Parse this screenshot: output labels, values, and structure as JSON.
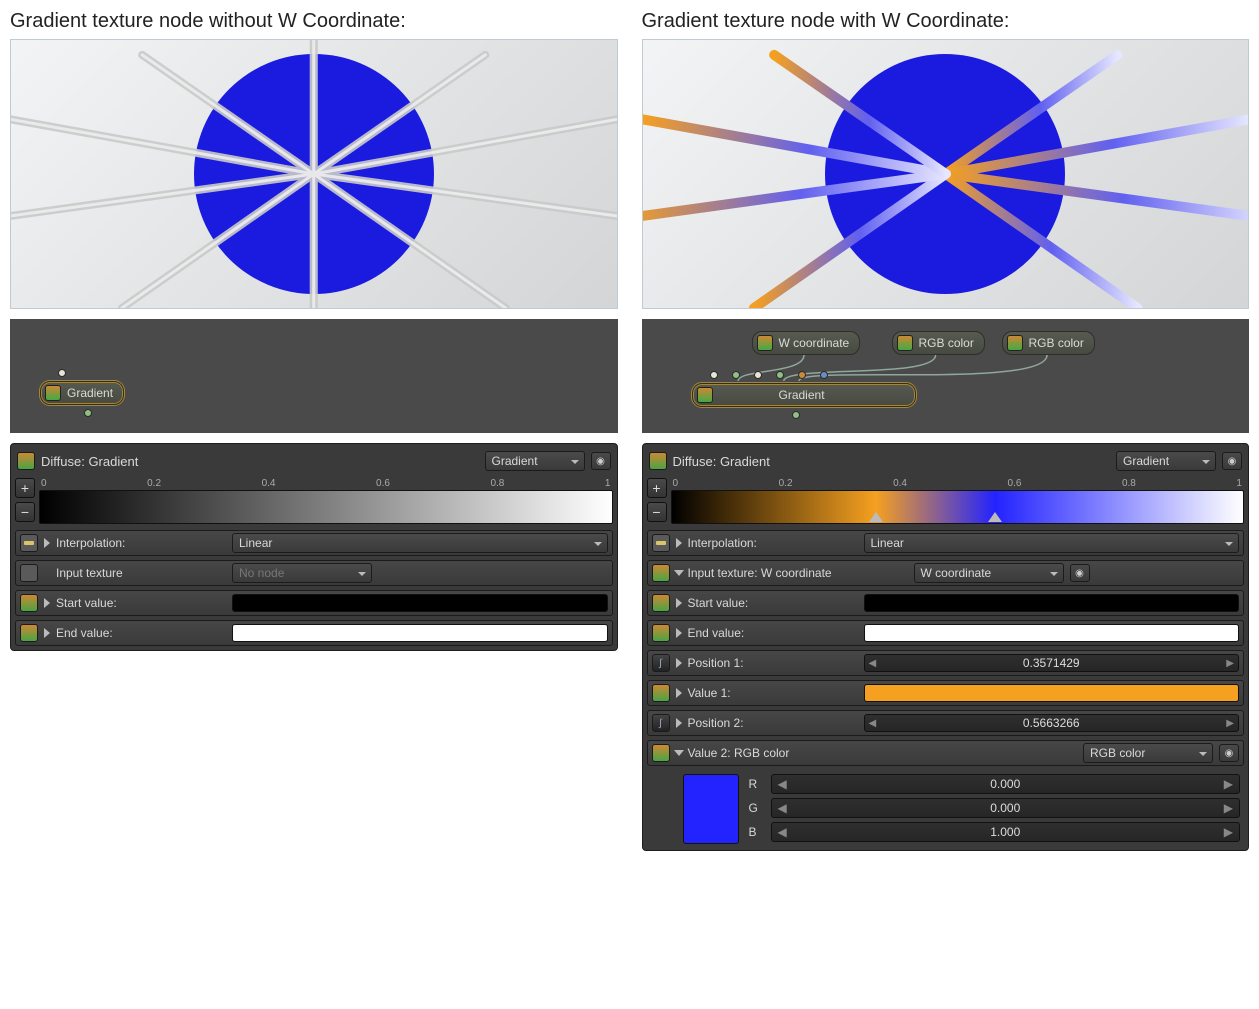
{
  "captions": {
    "left": "Gradient texture node without W Coordinate:",
    "right": "Gradient texture node with W Coordinate:"
  },
  "nodes": {
    "left": {
      "gradient": "Gradient"
    },
    "right": {
      "gradient": "Gradient",
      "wcoord": "W coordinate",
      "rgb1": "RGB color",
      "rgb2": "RGB color"
    }
  },
  "panelLeft": {
    "title": "Diffuse: Gradient",
    "type": "Gradient",
    "ticks": [
      "0",
      "0.2",
      "0.4",
      "0.6",
      "0.8",
      "1"
    ],
    "rows": {
      "interpolation_label": "Interpolation:",
      "interpolation_value": "Linear",
      "input_label": "Input texture",
      "input_value": "No node",
      "start_label": "Start value:",
      "end_label": "End value:"
    }
  },
  "panelRight": {
    "title": "Diffuse: Gradient",
    "type": "Gradient",
    "ticks": [
      "0",
      "0.2",
      "0.4",
      "0.6",
      "0.8",
      "1"
    ],
    "stops": [
      0.357,
      0.566
    ],
    "rows": {
      "interpolation_label": "Interpolation:",
      "interpolation_value": "Linear",
      "input_label": "Input texture: W coordinate",
      "input_value": "W coordinate",
      "start_label": "Start value:",
      "end_label": "End value:",
      "pos1_label": "Position 1:",
      "pos1_value": "0.3571429",
      "val1_label": "Value 1:",
      "pos2_label": "Position 2:",
      "pos2_value": "0.5663266",
      "val2_label": "Value 2: RGB color",
      "val2_type": "RGB color",
      "rgb": {
        "R": "0.000",
        "G": "0.000",
        "B": "1.000"
      }
    }
  },
  "colors": {
    "disc": "#1b1be0",
    "orange": "#f5a020",
    "blue": "#2323ff"
  }
}
